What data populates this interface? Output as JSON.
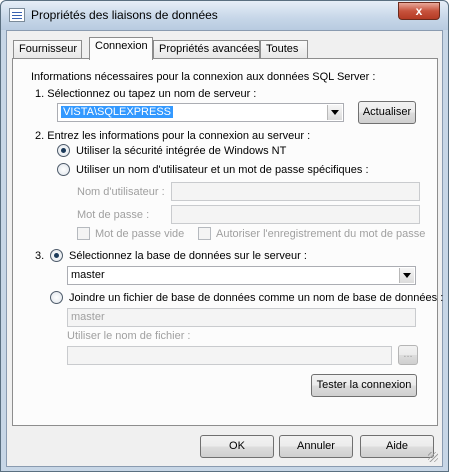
{
  "window": {
    "title": "Propriétés des liaisons de données",
    "close_glyph": "x"
  },
  "tabs": [
    {
      "label": "Fournisseur"
    },
    {
      "label": "Connexion"
    },
    {
      "label": "Propriétés avancées"
    },
    {
      "label": "Toutes"
    }
  ],
  "connection": {
    "intro": "Informations nécessaires pour la connexion aux données SQL Server :",
    "step1": {
      "label": "1. Sélectionnez ou tapez un nom de serveur :",
      "server_value": "VISTA\\SQLEXPRESS",
      "refresh_button": "Actualiser"
    },
    "step2": {
      "label": "2. Entrez les informations pour la connexion au serveur :",
      "option_windows": "Utiliser la sécurité intégrée de Windows NT",
      "option_user": "Utiliser un nom d'utilisateur et un mot de passe spécifiques :",
      "username_label": "Nom d'utilisateur :",
      "password_label": "Mot de passe :",
      "blank_password": "Mot de passe vide",
      "allow_save": "Autoriser l'enregistrement du mot de passe"
    },
    "step3": {
      "number": "3.",
      "option_select_db": "Sélectionnez la base de données sur le serveur :",
      "database_value": "master",
      "option_attach": "Joindre un fichier de base de données comme un nom de base de données :",
      "attach_name_value": "master",
      "filename_label": "Utiliser le nom de fichier :",
      "browse_button": "..."
    },
    "test_button": "Tester la connexion"
  },
  "footer": {
    "ok": "OK",
    "cancel": "Annuler",
    "help": "Aide"
  }
}
